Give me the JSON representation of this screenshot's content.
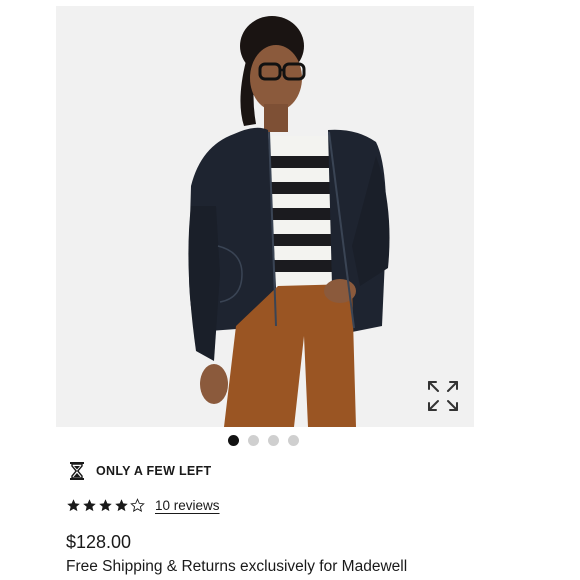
{
  "product": {
    "image": {
      "alt": "Model wearing navy open-front jacket over striped top with rust-colored jeans",
      "icon": "expand-arrows-icon",
      "colors": {
        "background": "#f1f1f1",
        "jacket": "#1e2430",
        "stripe_dark": "#1b1b1f",
        "stripe_light": "#f3f3f0",
        "jeans": "#9a5523",
        "skin": "#8b5a3c",
        "hair": "#1a1412"
      }
    },
    "carousel": {
      "total": 4,
      "active_index": 0
    },
    "stock": {
      "icon": "hourglass-icon",
      "label": "ONLY A FEW LEFT"
    },
    "rating": {
      "value": 4,
      "max": 5,
      "reviews_label": "10 reviews"
    },
    "price": "$128.00",
    "shipping_note": "Free Shipping & Returns exclusively for Madewell"
  }
}
